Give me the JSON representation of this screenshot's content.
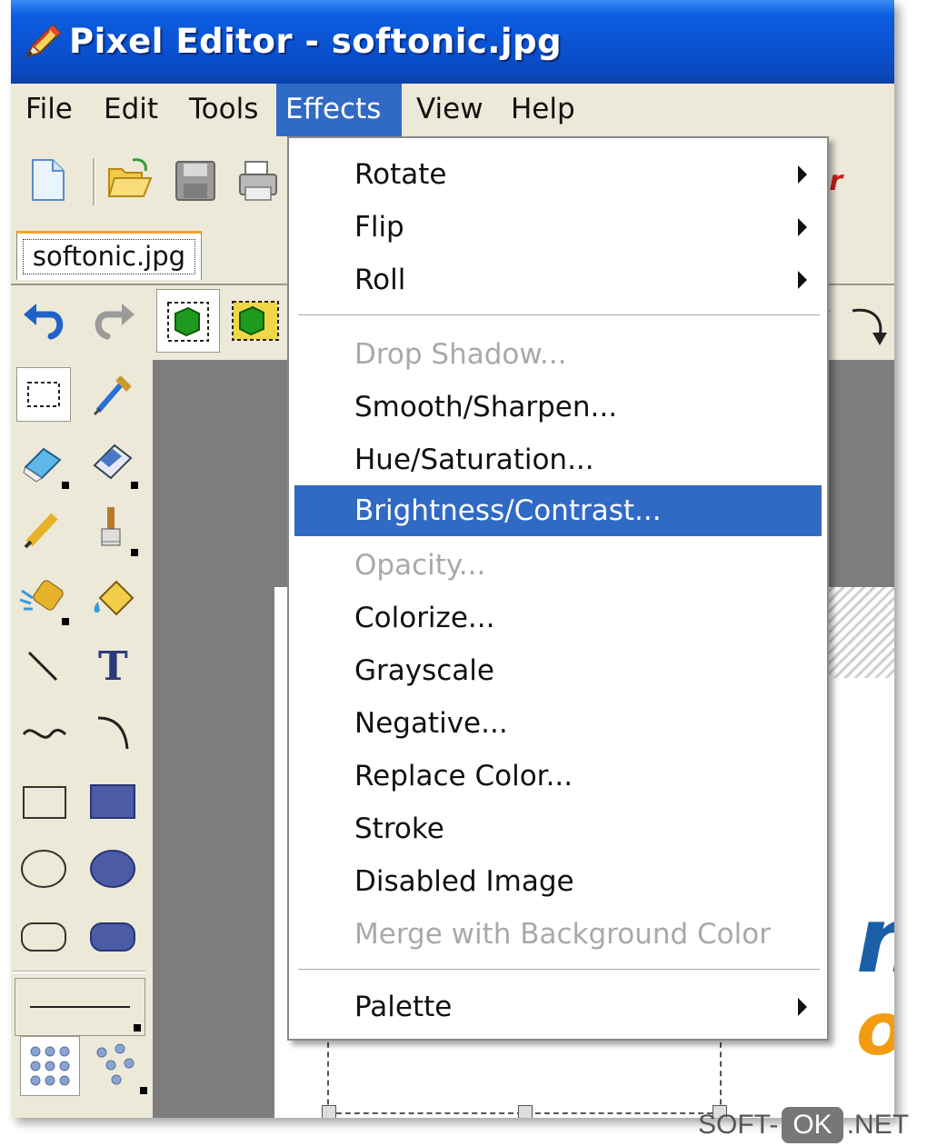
{
  "window": {
    "title": "Pixel Editor - softonic.jpg"
  },
  "menubar": {
    "items": [
      {
        "label": "File",
        "active": false
      },
      {
        "label": "Edit",
        "active": false
      },
      {
        "label": "Tools",
        "active": false
      },
      {
        "label": "Effects",
        "active": true
      },
      {
        "label": "View",
        "active": false
      },
      {
        "label": "Help",
        "active": false
      }
    ]
  },
  "toolbar": {
    "buttons": [
      "new-file-icon",
      "open-folder-icon",
      "save-disk-icon",
      "print-icon"
    ]
  },
  "tabs": {
    "active": "softonic.jpg"
  },
  "effects_menu": {
    "items": [
      {
        "label": "Rotate",
        "enabled": true,
        "submenu": true
      },
      {
        "label": "Flip",
        "enabled": true,
        "submenu": true
      },
      {
        "label": "Roll",
        "enabled": true,
        "submenu": true
      },
      {
        "separator": true
      },
      {
        "label": "Drop Shadow...",
        "enabled": false
      },
      {
        "label": "Smooth/Sharpen...",
        "enabled": true
      },
      {
        "label": "Hue/Saturation...",
        "enabled": true
      },
      {
        "label": "Brightness/Contrast...",
        "enabled": true,
        "highlighted": true
      },
      {
        "label": "Opacity...",
        "enabled": false
      },
      {
        "label": "Colorize...",
        "enabled": true
      },
      {
        "label": "Grayscale",
        "enabled": true
      },
      {
        "label": "Negative...",
        "enabled": true
      },
      {
        "label": "Replace Color...",
        "enabled": true
      },
      {
        "label": "Stroke",
        "enabled": true
      },
      {
        "label": "Disabled Image",
        "enabled": true
      },
      {
        "label": "Merge with Background Color",
        "enabled": false
      },
      {
        "separator": true
      },
      {
        "label": "Palette",
        "enabled": true,
        "submenu": true
      }
    ]
  },
  "tools": [
    "rect-select-icon",
    "eyedropper-icon",
    "eraser-icon",
    "color-eraser-icon",
    "pencil-icon",
    "brush-icon",
    "spray-icon",
    "fill-bucket-icon",
    "line-icon",
    "text-icon",
    "curve-icon",
    "arc-icon",
    "rectangle-icon",
    "filled-rectangle-icon",
    "ellipse-icon",
    "filled-ellipse-icon",
    "rounded-rect-icon",
    "filled-rounded-rect-icon"
  ],
  "canvas_text": {
    "logo_top": "ni",
    "logo_bottom": "or",
    "toolbar_partial": "er"
  },
  "colors": {
    "title_bar": "#0a52d2",
    "menu_highlight": "#316ac5",
    "disabled_text": "#a9a9a9",
    "logo_blue": "#1b5fa8",
    "logo_orange": "#f39c12"
  },
  "watermark": {
    "left": "SOFT-",
    "ok": "OK",
    "right": ".NET"
  }
}
